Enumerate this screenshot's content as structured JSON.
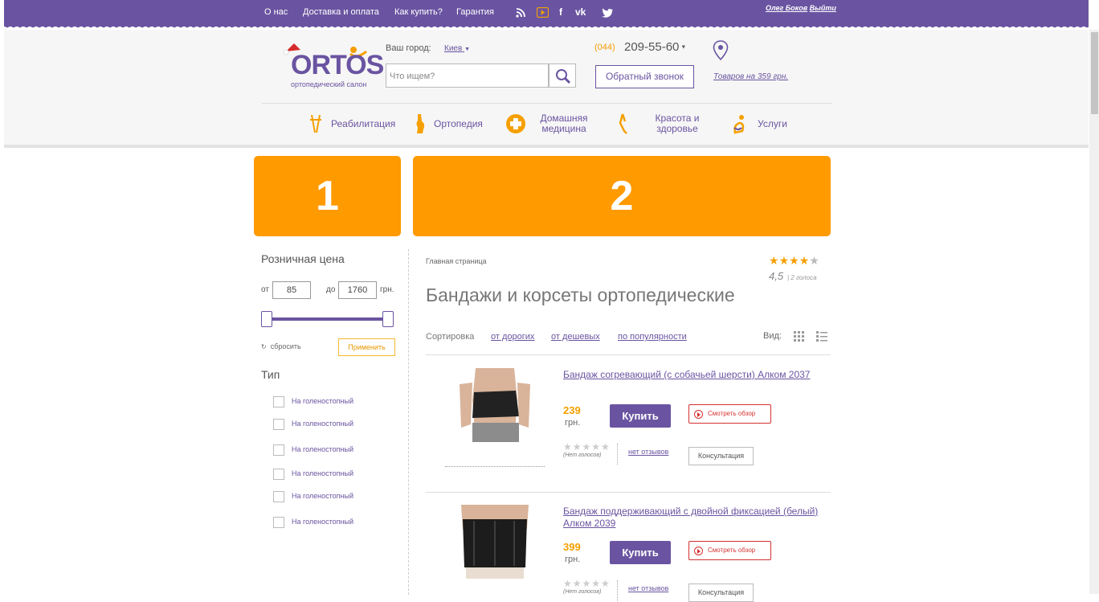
{
  "topbar": {
    "links": [
      "О нас",
      "Доставка и оплата",
      "Как купить?",
      "Гарантия"
    ],
    "user_name": "Олег Боков",
    "logout": "Выйти"
  },
  "header": {
    "logo_text": "ORTOS",
    "logo_sub": "ортопедический салон",
    "city_label": "Ваш город:",
    "city_value": "Киев",
    "search_placeholder": "Что ищем?",
    "phone_code": "(044)",
    "phone_number": "209-55-60",
    "callback_label": "Обратный звонок",
    "cart_text": "Товаров на 359 грн."
  },
  "nav": [
    {
      "label": "Реабилитация",
      "icon": "crutches-icon"
    },
    {
      "label": "Ортопедия",
      "icon": "knee-icon"
    },
    {
      "label": "Домашняя медицина",
      "icon": "medical-cross-icon"
    },
    {
      "label": "Красота и здоровье",
      "icon": "leg-icon"
    },
    {
      "label": "Услуги",
      "icon": "person-icon"
    }
  ],
  "banners": [
    "1",
    "2"
  ],
  "filter": {
    "price_title": "Розничная цена",
    "from_label": "от",
    "from_value": "85",
    "to_label": "до",
    "to_value": "1760",
    "currency": "грн.",
    "reset_label": "сбросить",
    "apply_label": "Применить",
    "type_title": "Тип",
    "type_options": [
      "На голеностопный",
      "На голеностопный",
      "На голеностопный",
      "На голеностопный",
      "На голеностопный",
      "На голеностопный"
    ]
  },
  "content": {
    "breadcrumb": "Главная страница",
    "rating_value": "4,5",
    "rating_votes": "| 2 голоса",
    "rating_stars": 4,
    "title": "Бандажи и корсеты ортопедические",
    "sort_label": "Сортировка",
    "sort_options": [
      "от дорогих",
      "от дешевых",
      "по популярности"
    ],
    "view_label": "Вид:"
  },
  "products": [
    {
      "name": "Бандаж согревающий (с собачьей шерсти) Алком 2037",
      "price": "239",
      "currency": "грн.",
      "buy_label": "Купить",
      "review_label": "Смотреть обзор",
      "no_votes": "(Нет голосов)",
      "no_reviews": "нет отзывов",
      "consult_label": "Консультация"
    },
    {
      "name": "Бандаж поддерживающий с двойной фиксацией (белый) Алком 2039",
      "price": "399",
      "currency": "грн.",
      "buy_label": "Купить",
      "review_label": "Смотреть обзор",
      "no_votes": "(Нет голосов)",
      "no_reviews": "нет отзывов",
      "consult_label": "Консультация"
    }
  ],
  "colors": {
    "brand": "#6a54a1",
    "accent": "#ff9a00",
    "alert": "#d53030"
  }
}
